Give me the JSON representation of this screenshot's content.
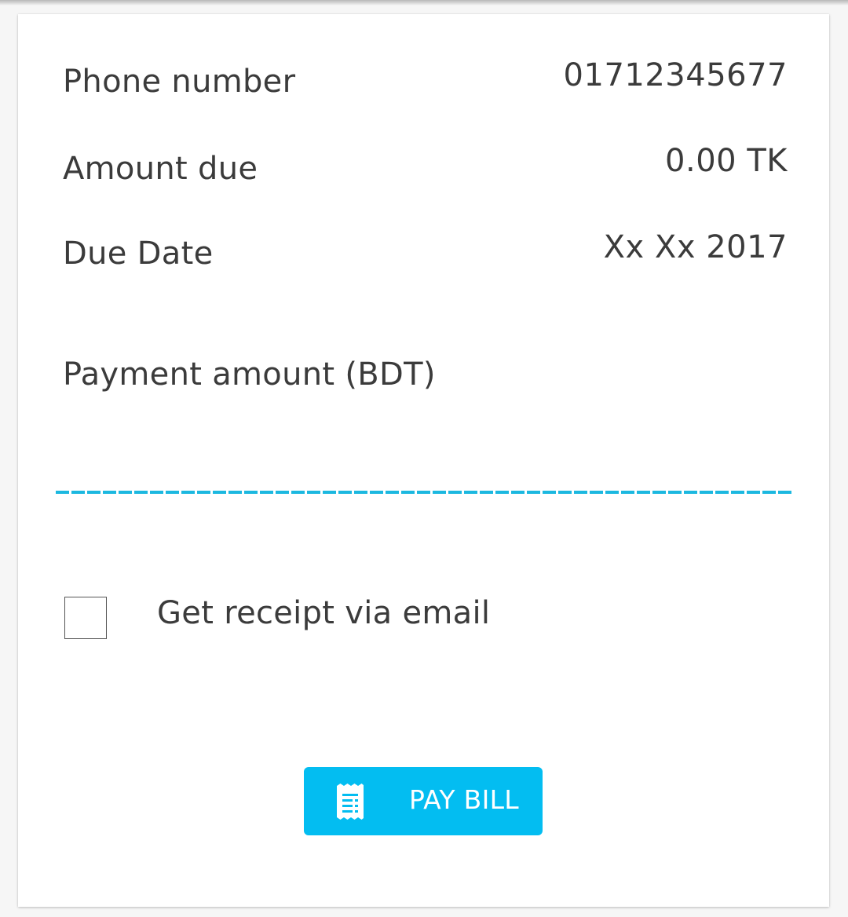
{
  "details": [
    {
      "label": "Phone number",
      "value": "01712345677"
    },
    {
      "label": "Amount due",
      "value": "0.00 TK"
    },
    {
      "label": "Due Date",
      "value": "Xx Xx 2017"
    }
  ],
  "payment": {
    "label": "Payment amount (BDT)",
    "value": ""
  },
  "receipt": {
    "label": "Get receipt via email",
    "checked": false
  },
  "pay_button": {
    "label": "PAY BILL",
    "icon": "receipt-icon"
  },
  "colors": {
    "accent": "#03bdf1",
    "underline": "#1cb8e0",
    "text": "#3b3b3b"
  }
}
